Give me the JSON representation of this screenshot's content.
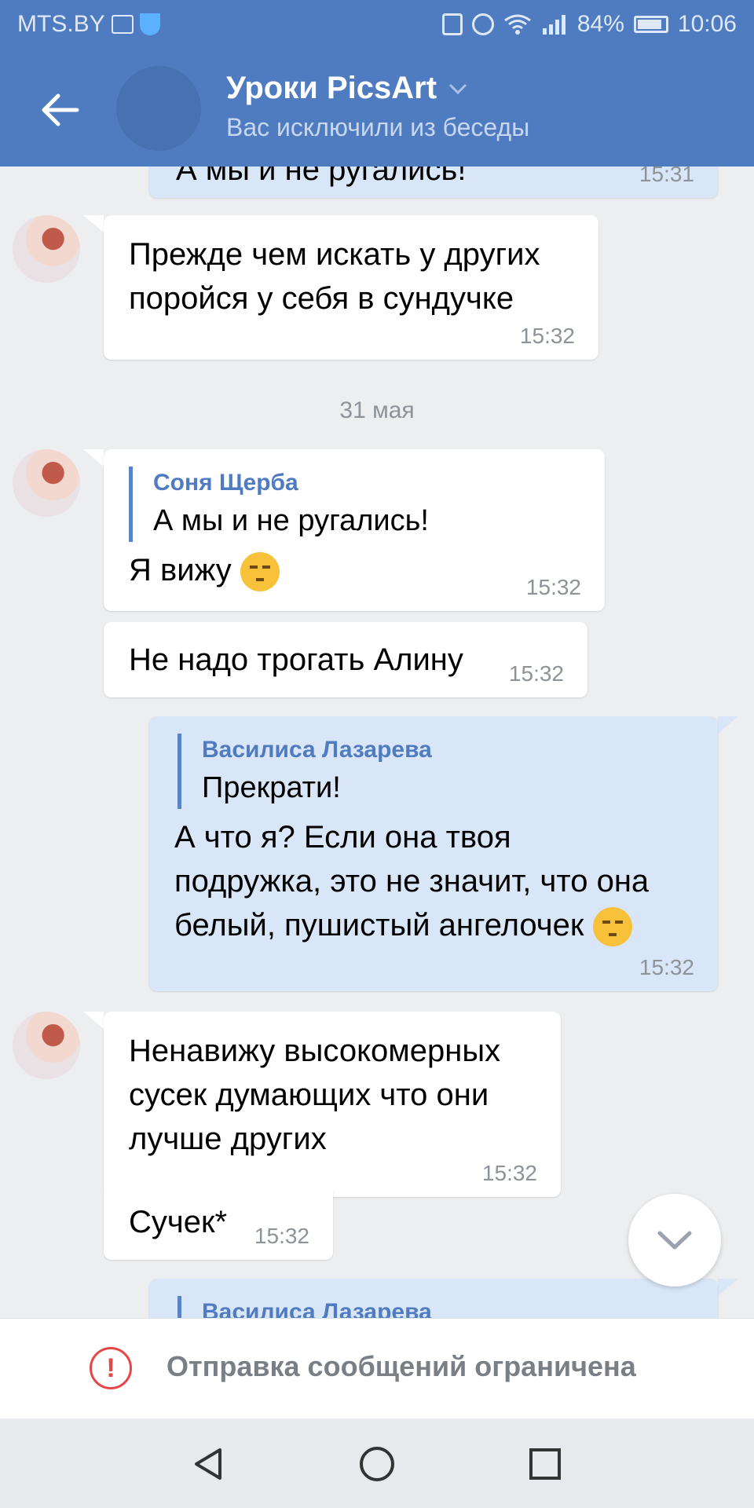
{
  "status_bar": {
    "carrier": "MTS.BY",
    "battery": "84%",
    "time": "10:06"
  },
  "header": {
    "title": "Уроки PicsArt",
    "subtitle": "Вас исключили из беседы"
  },
  "messages": [
    {
      "text": "А мы и не ругались!",
      "time": "15:31"
    },
    {
      "text1": "Прежде чем искать у других",
      "text2": "поройся у себя в сундучке",
      "time": "15:32"
    },
    {
      "date": "31 мая"
    },
    {
      "reply_name": "Соня Щерба",
      "reply_text": "А мы и не ругались!",
      "text": "Я вижу",
      "time": "15:32"
    },
    {
      "text": "Не надо трогать Алину",
      "time": "15:32"
    },
    {
      "reply_name": "Василиса Лазарева",
      "reply_text": "Прекрати!",
      "text1": "А что я? Если она твоя",
      "text2": "подружка, это не значит, что она",
      "text3": "белый, пушистый ангелочек",
      "time": "15:32"
    },
    {
      "text1": "Ненавижу высокомерных",
      "text2": "сусек думающих что они",
      "text3": "лучше  других",
      "time": "15:32"
    },
    {
      "text": "Сучек*",
      "time": "15:32"
    },
    {
      "reply_name": "Василиса Лазарева"
    }
  ],
  "restriction": {
    "icon": "!",
    "text": "Отправка сообщений ограничена"
  },
  "colors": {
    "header": "#4f7cc0",
    "outgoing_bubble": "#d9e6f8",
    "background": "#edeef0",
    "warning": "#e64646"
  }
}
